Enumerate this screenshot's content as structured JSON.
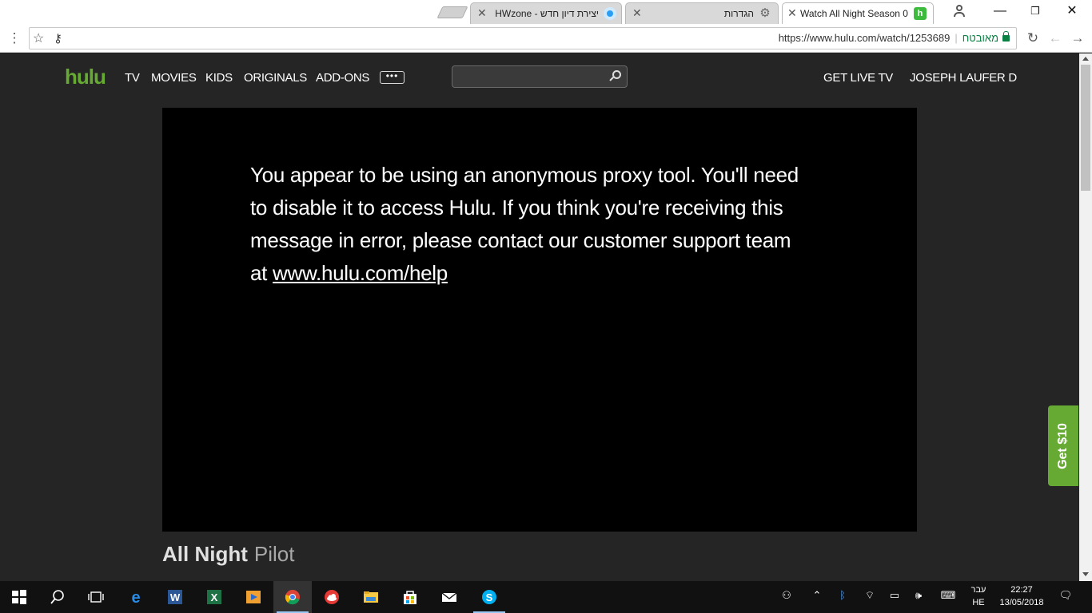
{
  "browser": {
    "tabs": [
      {
        "title": "Watch All Night Season 0",
        "favicon": "hulu-favicon",
        "active": true
      },
      {
        "title": "הגדרות",
        "favicon": "gear-icon",
        "active": false
      },
      {
        "title": "יצירת דיון חדש - HWzone",
        "favicon": "hwzone-favicon",
        "active": false
      }
    ],
    "url": "https://www.hulu.com/watch/1253689",
    "secure_label": "מאובטח"
  },
  "hulu": {
    "logo": "hulu",
    "nav": [
      "TV",
      "MOVIES",
      "KIDS",
      "ORIGINALS",
      "ADD-ONS"
    ],
    "more_label": "•••",
    "search_placeholder": "",
    "get_live_tv": "GET LIVE TV",
    "user_name": "JOSEPH LAUFER D",
    "player": {
      "message": "You appear to be using an anonymous proxy tool. You'll need to disable it to access Hulu. If you think you're receiving this message in error, please contact our customer support team at",
      "help_link": "www.hulu.com/help"
    },
    "show_title": "All Night",
    "episode_title": "Pilot",
    "promo_button": "Get $10"
  },
  "taskbar": {
    "apps": [
      "start",
      "search",
      "task-view",
      "edge",
      "word",
      "excel",
      "media-player",
      "chrome",
      "cloud",
      "file-explorer",
      "store",
      "mail",
      "skype"
    ],
    "language_top": "עבר",
    "language_bottom": "HE",
    "time": "22:27",
    "date": "13/05/2018"
  },
  "colors": {
    "hulu_green": "#66aa33",
    "page_bg": "#252525",
    "player_bg": "#000000",
    "taskbar_bg": "#111111"
  }
}
